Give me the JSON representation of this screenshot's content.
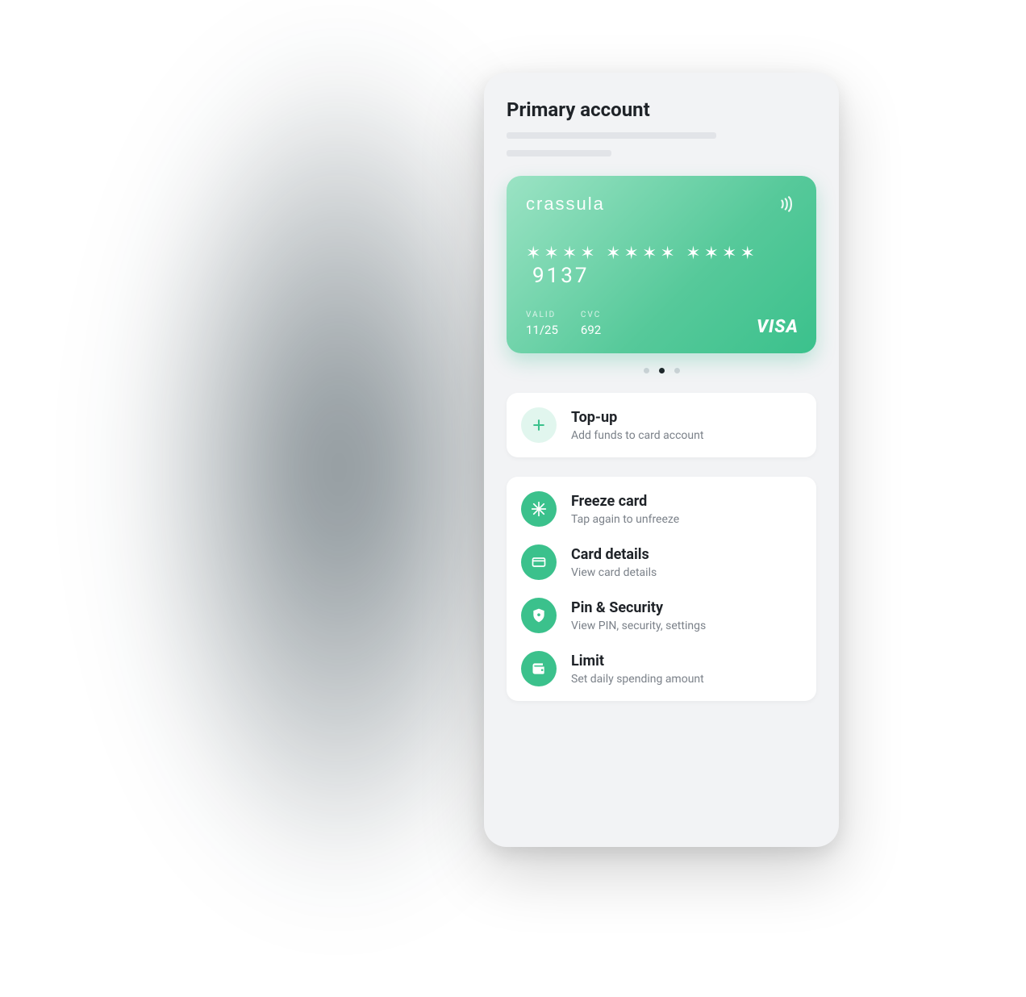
{
  "header": {
    "title": "Primary account"
  },
  "card": {
    "brand": "crassula",
    "masked": "✶✶✶✶  ✶✶✶✶  ✶✶✶✶",
    "last4": "9137",
    "valid_label": "VALID",
    "valid_value": "11/25",
    "cvc_label": "CVC",
    "cvc_value": "692",
    "network": "VISA"
  },
  "carousel": {
    "count": 3,
    "active_index": 1
  },
  "topup": {
    "title": "Top-up",
    "subtitle": "Add funds to card account"
  },
  "actions": [
    {
      "icon": "snowflake-icon",
      "title": "Freeze card",
      "subtitle": "Tap again to unfreeze"
    },
    {
      "icon": "card-icon",
      "title": "Card details",
      "subtitle": "View card details"
    },
    {
      "icon": "shield-icon",
      "title": "Pin & Security",
      "subtitle": "View PIN, security, settings"
    },
    {
      "icon": "wallet-icon",
      "title": "Limit",
      "subtitle": "Set daily  spending amount"
    }
  ],
  "colors": {
    "accent": "#3bc18c"
  }
}
